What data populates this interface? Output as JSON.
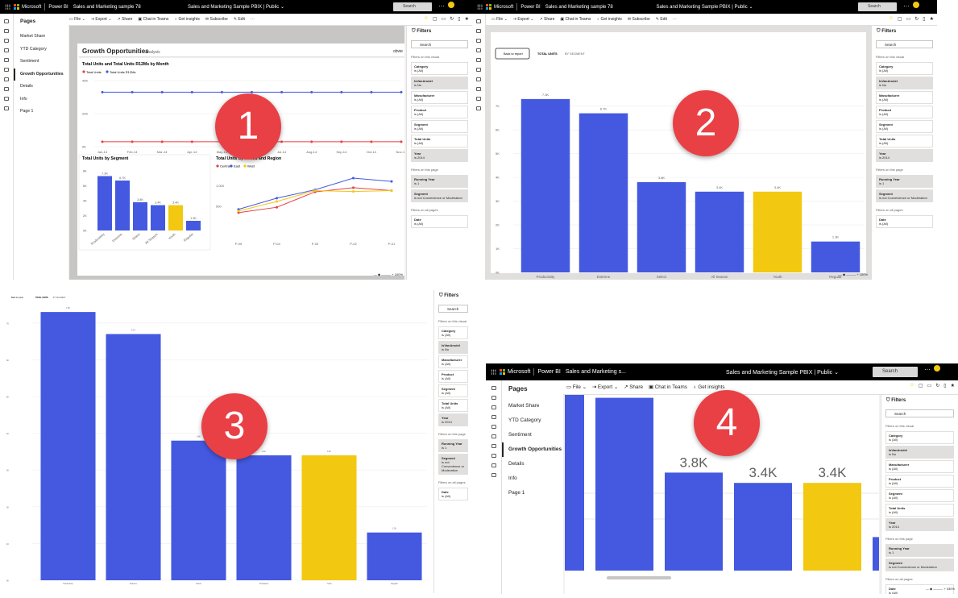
{
  "colors": {
    "accent": "#4459e0",
    "yellow": "#f2c811",
    "red": "#e84045",
    "dark": "#252423"
  },
  "app": {
    "ms": "Microsoft",
    "product": "Power BI",
    "workspace": "Sales and Marketing sample 78",
    "workspace_short": "Sales and Marketing s...",
    "report": "Sales and Marketing Sample PBIX",
    "visibility": "Public",
    "search": "Search"
  },
  "toolbar": {
    "file": "File",
    "export": "Export",
    "share": "Share",
    "teams": "Chat in Teams",
    "insights": "Get insights",
    "subscribe": "Subscribe",
    "edit": "Edit",
    "more": "···"
  },
  "pages": {
    "title": "Pages",
    "items": [
      "Market Share",
      "YTD Category",
      "Sentiment",
      "Growth Opportunities",
      "Details",
      "Info",
      "Page 1"
    ],
    "active": "Growth Opportunities"
  },
  "filters": {
    "title": "Filters",
    "search": "Search",
    "visual_heading": "Filters on this visual",
    "visual": [
      {
        "name": "Category",
        "value": "is (All)"
      },
      {
        "name": "IsVanArsdel",
        "value": "is No"
      },
      {
        "name": "Manufacturer",
        "value": "is (All)"
      },
      {
        "name": "Product",
        "value": "is (All)"
      },
      {
        "name": "Segment",
        "value": "is (All)"
      },
      {
        "name": "Total Units",
        "value": "is (All)"
      },
      {
        "name": "Year",
        "value": "is 2014"
      }
    ],
    "page_heading": "Filters on this page",
    "page": [
      {
        "name": "Running Year",
        "value": "is 1"
      },
      {
        "name": "Segment",
        "value": "is not Convenience or Moderation"
      }
    ],
    "all_heading": "Filters on all pages",
    "all": [
      {
        "name": "Date",
        "value": "is (All)"
      }
    ]
  },
  "q1": {
    "report_title": "Growth Opportunities",
    "report_sub": "Analysis",
    "brand": "obvie",
    "line": {
      "title": "Total Units and Total Units R12Ms by Month",
      "legend": [
        "Total Units",
        "Total Units R12Ms"
      ],
      "months": [
        "Jan-14",
        "Feb-14",
        "Mar-14",
        "Apr-14",
        "May-14",
        "Jun-14",
        "Jul-14",
        "Aug-14",
        "Sep-14",
        "Oct-14",
        "Nov-14"
      ],
      "ticks": [
        "40K",
        "20K",
        "0K"
      ],
      "r12": [
        33,
        33,
        33,
        33,
        33,
        33,
        33,
        33,
        33,
        33,
        33
      ],
      "units": [
        3,
        3,
        3,
        3,
        3,
        3,
        3,
        3,
        3,
        3,
        3
      ],
      "ymax": 40
    },
    "seg": {
      "title": "Total Units by Segment",
      "ticks": [
        "8K",
        "6K",
        "4K",
        "2K",
        "0K"
      ],
      "ymax": 8
    },
    "period": {
      "title": "Total Units by Period and Region",
      "legend": [
        "Central",
        "East",
        "West"
      ],
      "x": [
        "P-05",
        "P-04",
        "P-03",
        "P-02",
        "P-01"
      ],
      "ticks": [
        "1,000",
        "500"
      ],
      "ymax": 1200,
      "central": [
        350,
        480,
        850,
        950,
        880
      ],
      "east": [
        430,
        700,
        900,
        1180,
        1100
      ],
      "west": [
        390,
        620,
        880,
        860,
        880
      ]
    }
  },
  "segment_chart": {
    "tab1": "TOTAL UNITS",
    "tab2": "BY SEGMENT",
    "back": "Back to report"
  },
  "chart_data": {
    "type": "bar",
    "categories": [
      "Productivity",
      "Extreme",
      "Select",
      "All Season",
      "Youth",
      "Regular"
    ],
    "values": [
      7.3,
      6.7,
      3.8,
      3.4,
      3.4,
      1.3
    ],
    "labels": [
      "7.3K",
      "6.7K",
      "3.8K",
      "3.4K",
      "3.4K",
      "1.3K"
    ],
    "ticks": [
      "7K",
      "6K",
      "5K",
      "4K",
      "3K",
      "2K",
      "1K",
      "0K"
    ],
    "ylim": [
      0,
      7.5
    ],
    "colors": [
      "#4459e0",
      "#4459e0",
      "#4459e0",
      "#4459e0",
      "#f2c811",
      "#4459e0"
    ]
  },
  "zoom": {
    "q1": "100%",
    "q2": "100%",
    "q4": "330%"
  },
  "markers": [
    "1",
    "2",
    "3",
    "4"
  ]
}
